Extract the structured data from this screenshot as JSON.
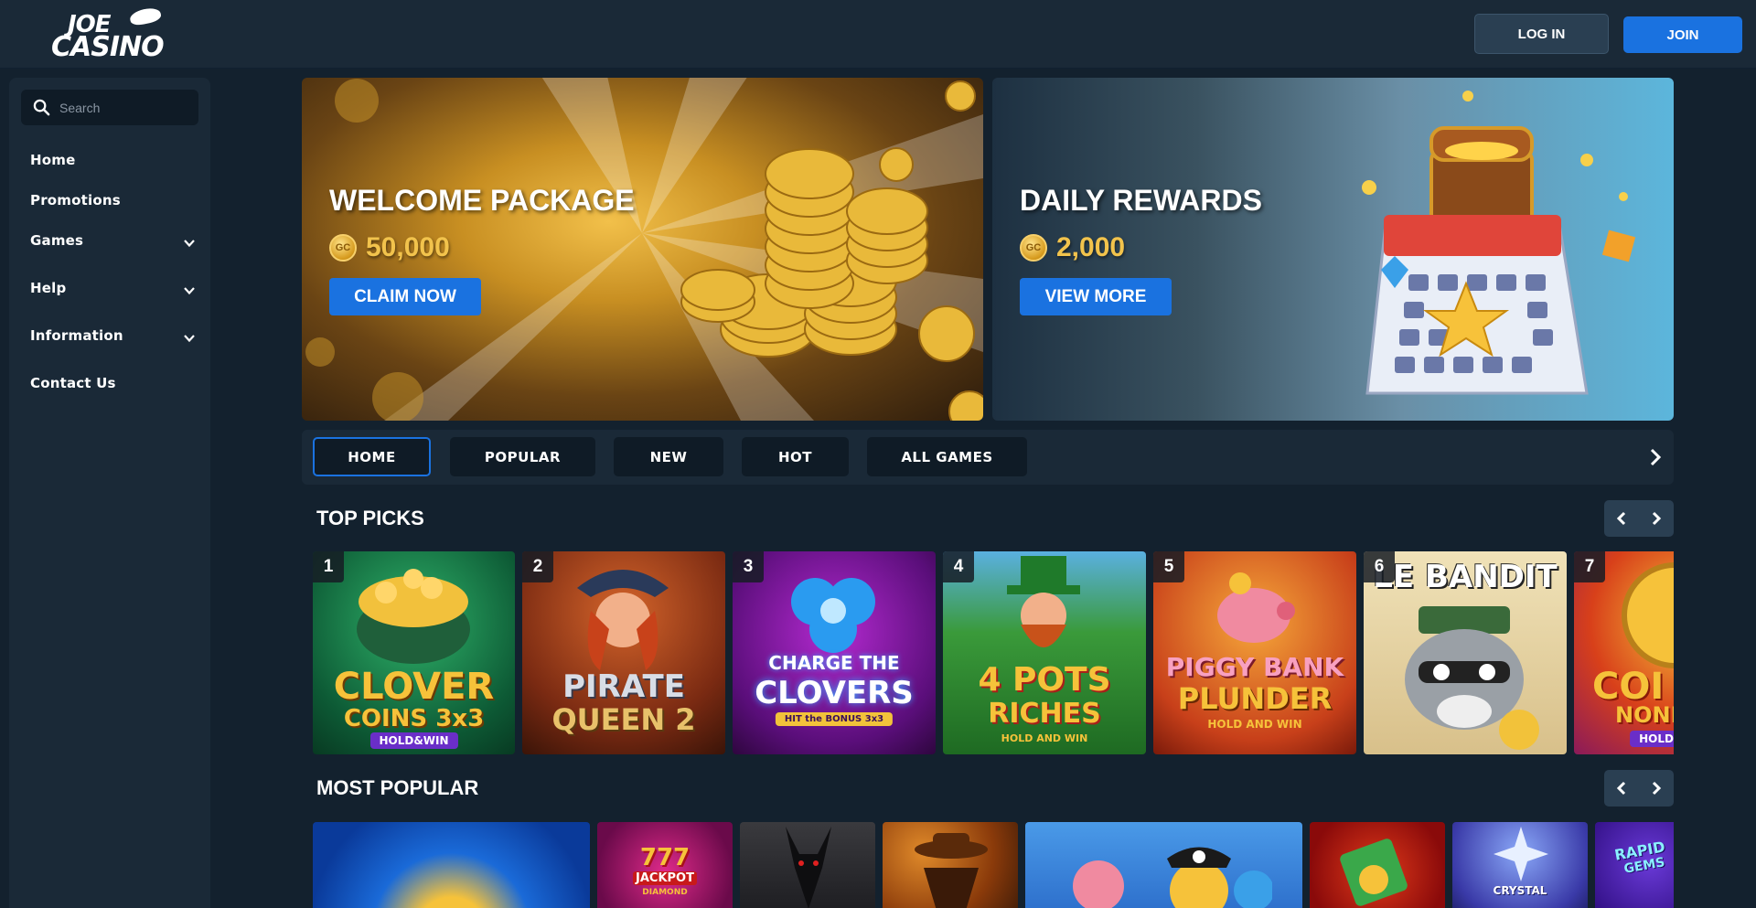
{
  "header": {
    "logo_line1": "JOE",
    "logo_line2": "CASINO",
    "login_label": "LOG IN",
    "join_label": "JOIN"
  },
  "sidebar": {
    "search_placeholder": "Search",
    "items": [
      {
        "label": "Home"
      },
      {
        "label": "Promotions"
      },
      {
        "label": "Games"
      },
      {
        "label": "Help"
      },
      {
        "label": "Information"
      },
      {
        "label": "Contact Us"
      }
    ]
  },
  "banners": {
    "welcome": {
      "title": "WELCOME PACKAGE",
      "amount": "50,000",
      "button": "CLAIM NOW",
      "coin": "GC"
    },
    "daily": {
      "title": "DAILY REWARDS",
      "amount": "2,000",
      "button": "VIEW MORE",
      "coin": "GC"
    }
  },
  "tabs": [
    {
      "label": "HOME"
    },
    {
      "label": "POPULAR"
    },
    {
      "label": "NEW"
    },
    {
      "label": "HOT"
    },
    {
      "label": "ALL GAMES"
    }
  ],
  "top_picks": {
    "title": "TOP PICKS",
    "games": [
      {
        "rank": "1",
        "line1": "CLOVER",
        "line2": "COINS 3x3",
        "badge": "HOLD&WIN"
      },
      {
        "rank": "2",
        "line1": "PIRATE",
        "line2": "QUEEN 2",
        "badge": ""
      },
      {
        "rank": "3",
        "line1": "CHARGE THE",
        "line2": "CLOVERS",
        "badge": "HIT the BONUS 3x3"
      },
      {
        "rank": "4",
        "line1": "4 POTS",
        "line2": "RICHES",
        "badge": "HOLD AND WIN"
      },
      {
        "rank": "5",
        "line1": "PIGGY BANK",
        "line2": "PLUNDER",
        "badge": "HOLD AND WIN"
      },
      {
        "rank": "6",
        "line1": "LE BANDIT",
        "line2": "",
        "badge": ""
      },
      {
        "rank": "7",
        "line1": "COI",
        "line2": "NONE",
        "badge": "HOLD"
      }
    ]
  },
  "most_popular": {
    "title": "MOST POPULAR",
    "games": [
      {
        "line1": ""
      },
      {
        "line1": "777",
        "line2": "JACKPOT",
        "line3": "DIAMOND"
      },
      {
        "line1": ""
      },
      {
        "line1": ""
      },
      {
        "line1": ""
      },
      {
        "line1": ""
      },
      {
        "line1": "CRYSTAL"
      },
      {
        "line1": "RAPID",
        "line2": "GEMS"
      }
    ]
  }
}
